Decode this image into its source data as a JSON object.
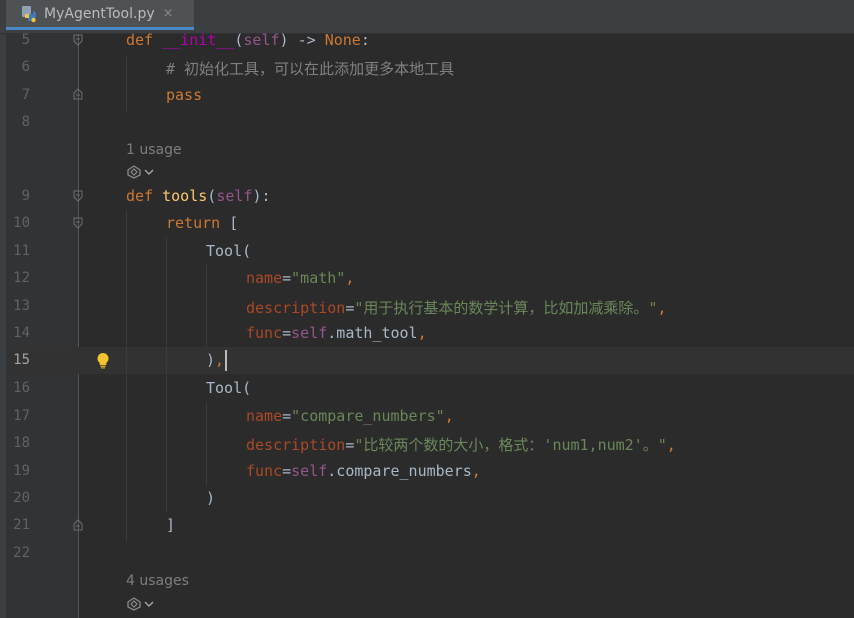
{
  "tab": {
    "title": "MyAgentTool.py",
    "close": "×"
  },
  "active_line": "15",
  "lines": [
    {
      "n": "5"
    },
    {
      "n": "6"
    },
    {
      "n": "7"
    },
    {
      "n": "8"
    },
    {
      "n": "9"
    },
    {
      "n": "10"
    },
    {
      "n": "11"
    },
    {
      "n": "12"
    },
    {
      "n": "13"
    },
    {
      "n": "14"
    },
    {
      "n": "15"
    },
    {
      "n": "16"
    },
    {
      "n": "17"
    },
    {
      "n": "18"
    },
    {
      "n": "19"
    },
    {
      "n": "20"
    },
    {
      "n": "21"
    },
    {
      "n": "22"
    }
  ],
  "code": {
    "l5": {
      "def": "def",
      "name": "__init__",
      "open": "(",
      "self": "self",
      "rest": ") -> ",
      "none": "None",
      "colon": ":"
    },
    "l6": {
      "comment": "# 初始化工具，可以在此添加更多本地工具"
    },
    "l7": {
      "pass": "pass"
    },
    "l9": {
      "def": "def",
      "name": "tools",
      "open": "(",
      "self": "self",
      "close": "):"
    },
    "l10": {
      "ret": "return",
      "bracket": " ["
    },
    "l11": {
      "text": "Tool("
    },
    "l12": {
      "key": "name",
      "eq": "=",
      "val": "\"math\"",
      "comma": ","
    },
    "l13": {
      "key": "description",
      "eq": "=",
      "val": "\"用于执行基本的数学计算，比如加减乘除。\"",
      "comma": ","
    },
    "l14": {
      "key": "func",
      "eq": "=",
      "self": "self",
      "attr": ".math_tool",
      "comma": ","
    },
    "l15": {
      "paren": ")",
      "comma": ","
    },
    "l16": {
      "text": "Tool("
    },
    "l17": {
      "key": "name",
      "eq": "=",
      "val": "\"compare_numbers\"",
      "comma": ","
    },
    "l18": {
      "key": "description",
      "eq": "=",
      "val": "\"比较两个数的大小，格式：'num1,num2'。\"",
      "comma": ","
    },
    "l19": {
      "key": "func",
      "eq": "=",
      "self": "self",
      "attr": ".compare_numbers",
      "comma": ","
    },
    "l20": {
      "text": ")"
    },
    "l21": {
      "text": "]"
    }
  },
  "hints": {
    "usage1": "1 usage",
    "usage2": "4 usages"
  },
  "colors": {
    "background": "#2b2b2b",
    "keyword": "#cc7832",
    "self": "#94558d",
    "function": "#ffc66d",
    "string": "#6a8759",
    "kwarg": "#aa4926",
    "comment": "#808080",
    "tab_underline": "#4a88c7"
  }
}
